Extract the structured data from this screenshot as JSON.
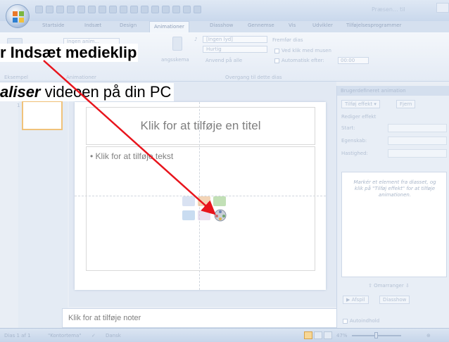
{
  "quick_access_title": "Præsen... til",
  "tabs": [
    "Startside",
    "Indsæt",
    "Design",
    "Animationer",
    "Diasshow",
    "Gennemse",
    "Vis",
    "Udvikler",
    "Tilføjelsesprogrammer"
  ],
  "active_tab_index": 3,
  "ribbon": {
    "no_animation": "Ingen anim...",
    "transition_sound": "[Ingen lyd]",
    "transition_speed": "Hurtig",
    "apply_all": "Anvend på alle",
    "advance_slide": "Fremfør dias",
    "on_click": "Ved klik med musen",
    "auto_after": "Automatisk efter:",
    "auto_time": "00:00",
    "layout_label": "angsskema",
    "group_preview": "Eksempel",
    "group_animations": "Animationer",
    "group_transition": "Overgang til dette dias"
  },
  "thumbnail_number": "1",
  "slide": {
    "title_placeholder": "Klik for at tilføje en titel",
    "body_placeholder": "• Klik for at tilføje tekst"
  },
  "notes_placeholder": "Klik for at tilføje noter",
  "task_pane": {
    "title": "Brugerdefineret animation",
    "add_effect": "Tilføj effekt",
    "remove": "Fjern",
    "edit_effect": "Rediger effekt",
    "start_label": "Start:",
    "property_label": "Egenskab:",
    "speed_label": "Hastighed:",
    "hint": "Markér et element fra diasset, og klik på \"Tilføj effekt\" for at tilføje animationen.",
    "reorder": "Omarranger",
    "play": "Afspil",
    "slideshow": "Diasshow",
    "autopreview": "Autoindhold"
  },
  "status": {
    "slide_info": "Dias 1 af 1",
    "theme": "\"Kontortema\"",
    "language": "Dansk",
    "zoom": "47%"
  },
  "annotation": {
    "step_line": "r Indsæt medieklip",
    "find_word": "aliser",
    "find_rest": " videoen på din PC"
  },
  "colors": {
    "arrow": "#e8141c",
    "ribbon_bg": "#e4ebf5",
    "thumb_selected": "#f0c27a"
  }
}
